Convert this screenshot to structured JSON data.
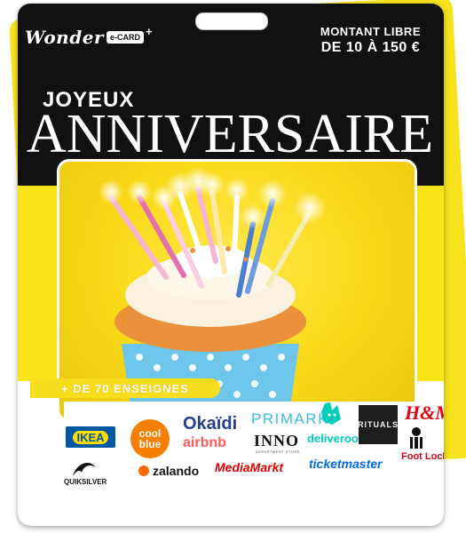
{
  "brand": {
    "name": "Wonder",
    "badge": "e-CARD",
    "plus": "+"
  },
  "amount": {
    "line1": "MONTANT LIBRE",
    "line2": "DE 10 À 150 €"
  },
  "greeting": {
    "small": "JOYEUX",
    "big": "ANNIVERSAIRE"
  },
  "banner": {
    "text": "+ DE 70 ENSEIGNES"
  },
  "logos": {
    "ikea": "IKEA",
    "coolblue_1": "cool",
    "coolblue_2": "blue",
    "okaidi": "Okaïdi",
    "primark": "PRIMARK",
    "deliveroo": "deliveroo",
    "rituals": "RITUALS",
    "hm": "H&M",
    "airbnb": "airbnb",
    "inno": "INNO",
    "inno_sub": "DEPARTMENT STORE",
    "footlocker": "Foot Locker",
    "quiksilver": "QUIKSILVER",
    "zalando": "zalando",
    "mediamarkt": "MediaMarkt",
    "ticketmaster": "ticketmaster"
  },
  "colors": {
    "card_black": "#111111",
    "card_yellow": "#f6e318",
    "photo_yellow": "#f8d916",
    "cup_blue": "#6ec6ea"
  },
  "icons": [
    "hang-hole",
    "candle",
    "cupcake",
    "deliveroo-kangaroo",
    "footlocker-referee",
    "quiksilver-wave"
  ]
}
